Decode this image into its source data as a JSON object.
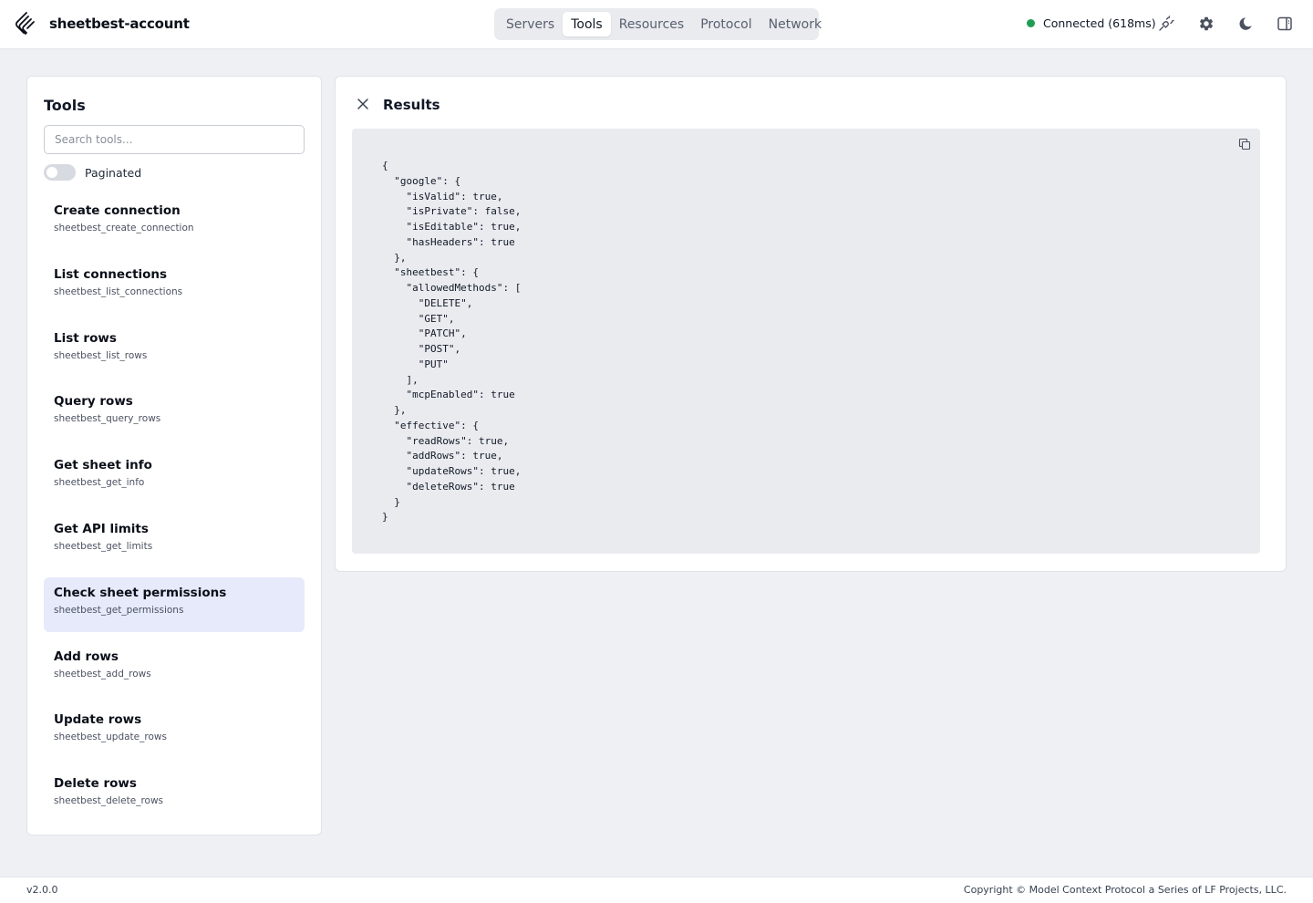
{
  "header": {
    "app_name": "sheetbest-account",
    "tabs": [
      {
        "label": "Servers"
      },
      {
        "label": "Tools"
      },
      {
        "label": "Resources"
      },
      {
        "label": "Protocol"
      },
      {
        "label": "Network"
      }
    ],
    "active_tab": "Tools",
    "status_text": "Connected (618ms)",
    "status_color": "#1f9d55",
    "icons": [
      "logo-icon",
      "plug-icon",
      "gear-icon",
      "moon-icon",
      "sidebar-toggle-icon"
    ]
  },
  "tools_panel": {
    "title": "Tools",
    "search_placeholder": "Search tools...",
    "paginated_label": "Paginated",
    "paginated_on": false,
    "items": [
      {
        "name": "Create connection",
        "id": "sheetbest_create_connection"
      },
      {
        "name": "List connections",
        "id": "sheetbest_list_connections"
      },
      {
        "name": "List rows",
        "id": "sheetbest_list_rows"
      },
      {
        "name": "Query rows",
        "id": "sheetbest_query_rows"
      },
      {
        "name": "Get sheet info",
        "id": "sheetbest_get_info"
      },
      {
        "name": "Get API limits",
        "id": "sheetbest_get_limits"
      },
      {
        "name": "Check sheet permissions",
        "id": "sheetbest_get_permissions"
      },
      {
        "name": "Add rows",
        "id": "sheetbest_add_rows"
      },
      {
        "name": "Update rows",
        "id": "sheetbest_update_rows"
      },
      {
        "name": "Delete rows",
        "id": "sheetbest_delete_rows"
      }
    ],
    "selected_item": "Check sheet permissions",
    "selected_color": "#e6eafa"
  },
  "results": {
    "title": "Results",
    "json_text": "{\n  \"google\": {\n    \"isValid\": true,\n    \"isPrivate\": false,\n    \"isEditable\": true,\n    \"hasHeaders\": true\n  },\n  \"sheetbest\": {\n    \"allowedMethods\": [\n      \"DELETE\",\n      \"GET\",\n      \"PATCH\",\n      \"POST\",\n      \"PUT\"\n    ],\n    \"mcpEnabled\": true\n  },\n  \"effective\": {\n    \"readRows\": true,\n    \"addRows\": true,\n    \"updateRows\": true,\n    \"deleteRows\": true\n  }\n}",
    "icons": [
      "close-icon",
      "copy-icon"
    ]
  },
  "footer": {
    "version": "v2.0.0",
    "copyright": "Copyright © Model Context Protocol a Series of LF Projects, LLC."
  }
}
